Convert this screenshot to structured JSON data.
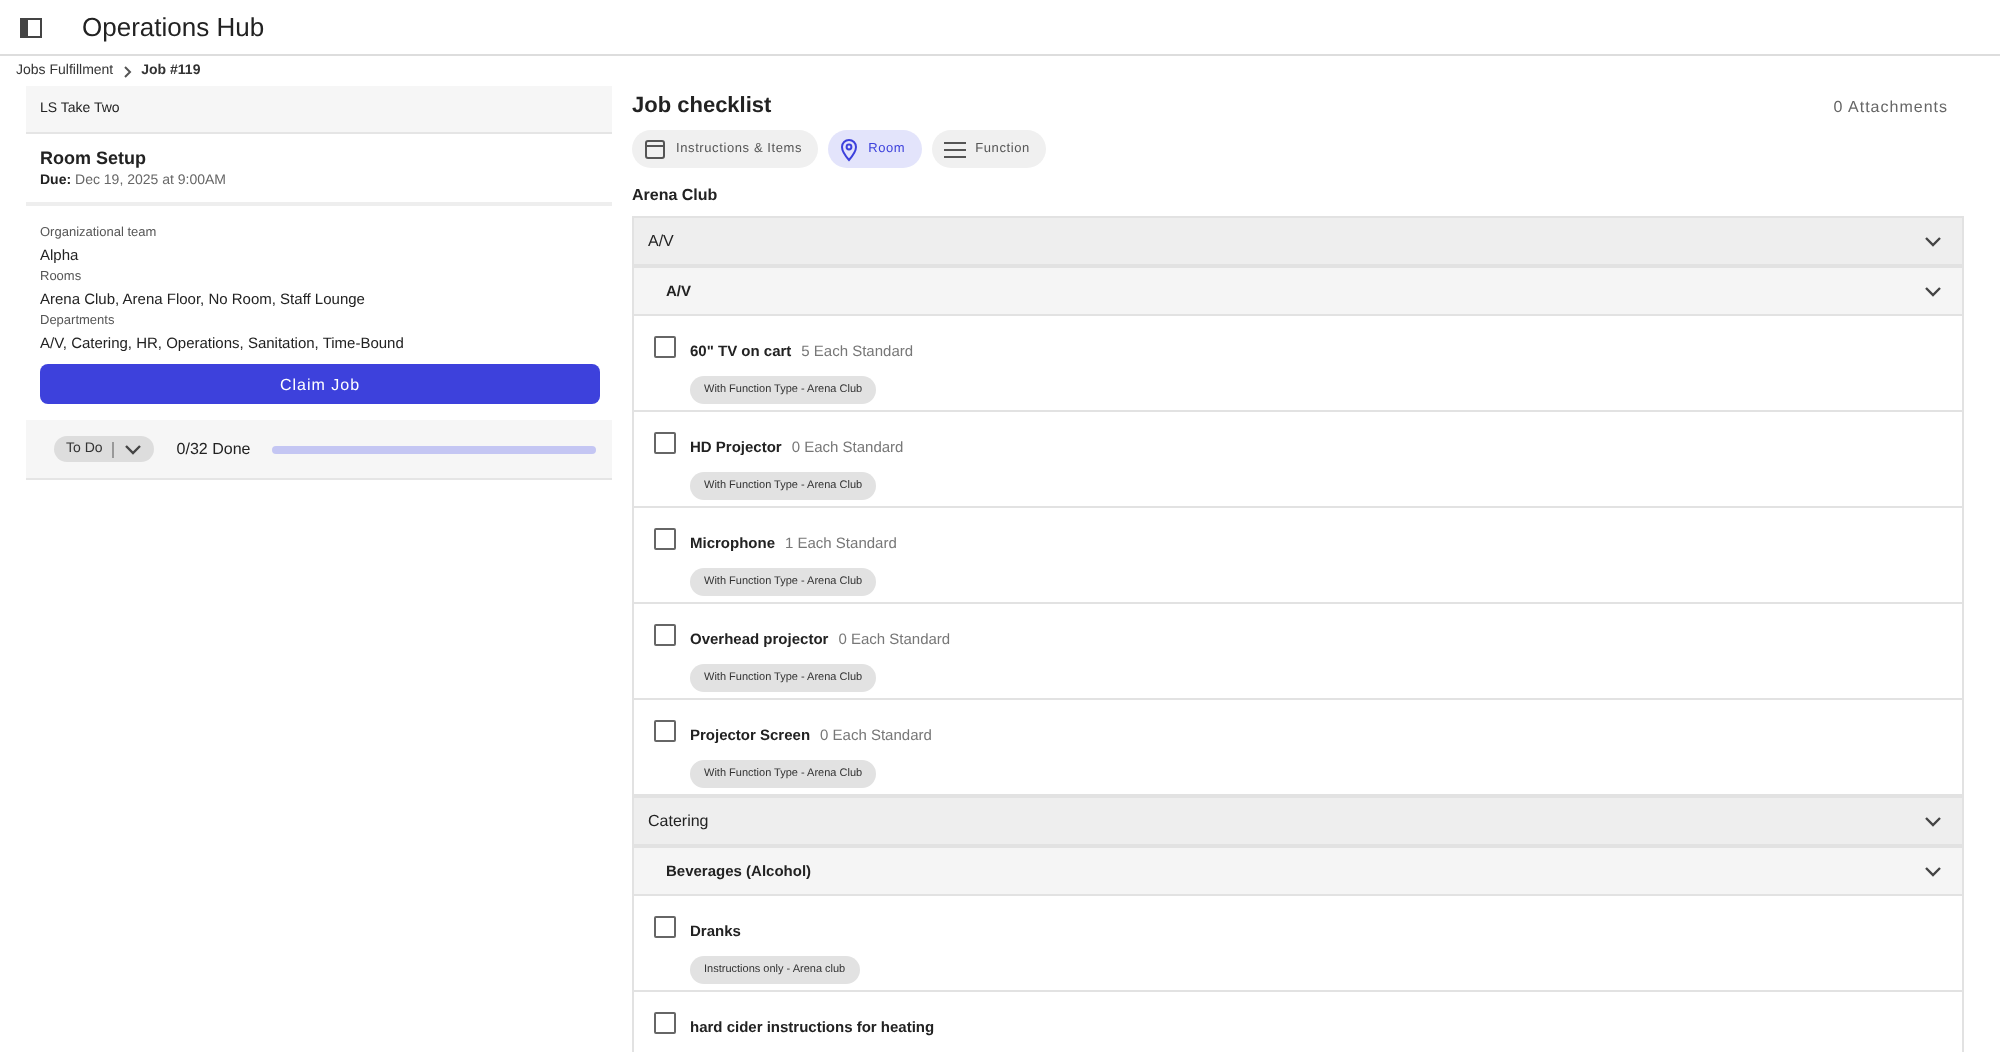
{
  "app_title": "Operations Hub",
  "breadcrumb": [
    {
      "label": "Jobs Fulfillment",
      "current": false
    },
    {
      "label": "Job #119",
      "current": true
    }
  ],
  "job": {
    "venue": "LS Take Two",
    "title": "Room Setup",
    "due_label": "Due:",
    "due": "Dec 19, 2025 at 9:00AM",
    "details": [
      {
        "label": "Organizational team",
        "value": "Alpha"
      },
      {
        "label": "Rooms",
        "value": "Arena Club, Arena Floor, No Room, Staff Lounge"
      },
      {
        "label": "Departments",
        "value": "A/V, Catering, HR, Operations, Sanitation, Time-Bound"
      }
    ],
    "claim_button": "Claim Job",
    "status": "To Do",
    "progress_text": "0/32 Done",
    "level": 0
  },
  "checklist": {
    "title": "Job checklist",
    "attachments": "0 Attachments",
    "tabs": [
      {
        "label": "Instructions & Items",
        "selected": false
      },
      {
        "label": "Room",
        "selected": true
      },
      {
        "label": "Function",
        "selected": false
      }
    ],
    "room": "Arena Club",
    "sections": [
      {
        "name": "A/V",
        "expanded": true,
        "groups": [
          {
            "name": "A/V",
            "expanded": true,
            "items": [
              {
                "name": "60\" TV on cart",
                "quantity": "5 Each Standard",
                "tag": "With Function Type - Arena Club",
                "checked": false
              },
              {
                "name": "HD Projector",
                "quantity": "0 Each Standard",
                "tag": "With Function Type - Arena Club",
                "checked": false
              },
              {
                "name": "Microphone",
                "quantity": "1 Each Standard",
                "tag": "With Function Type - Arena Club",
                "checked": false
              },
              {
                "name": "Overhead projector",
                "quantity": "0 Each Standard",
                "tag": "With Function Type - Arena Club",
                "checked": false
              },
              {
                "name": "Projector Screen",
                "quantity": "0 Each Standard",
                "tag": "With Function Type - Arena Club",
                "checked": false
              }
            ]
          }
        ]
      },
      {
        "name": "Catering",
        "expanded": true,
        "groups": [
          {
            "name": "Beverages (Alcohol)",
            "expanded": true,
            "items": [
              {
                "name": "Dranks",
                "tag": "Instructions only - Arena club",
                "checked": false
              },
              {
                "name": "hard cider instructions for heating",
                "checked": false
              }
            ]
          }
        ]
      }
    ]
  }
}
